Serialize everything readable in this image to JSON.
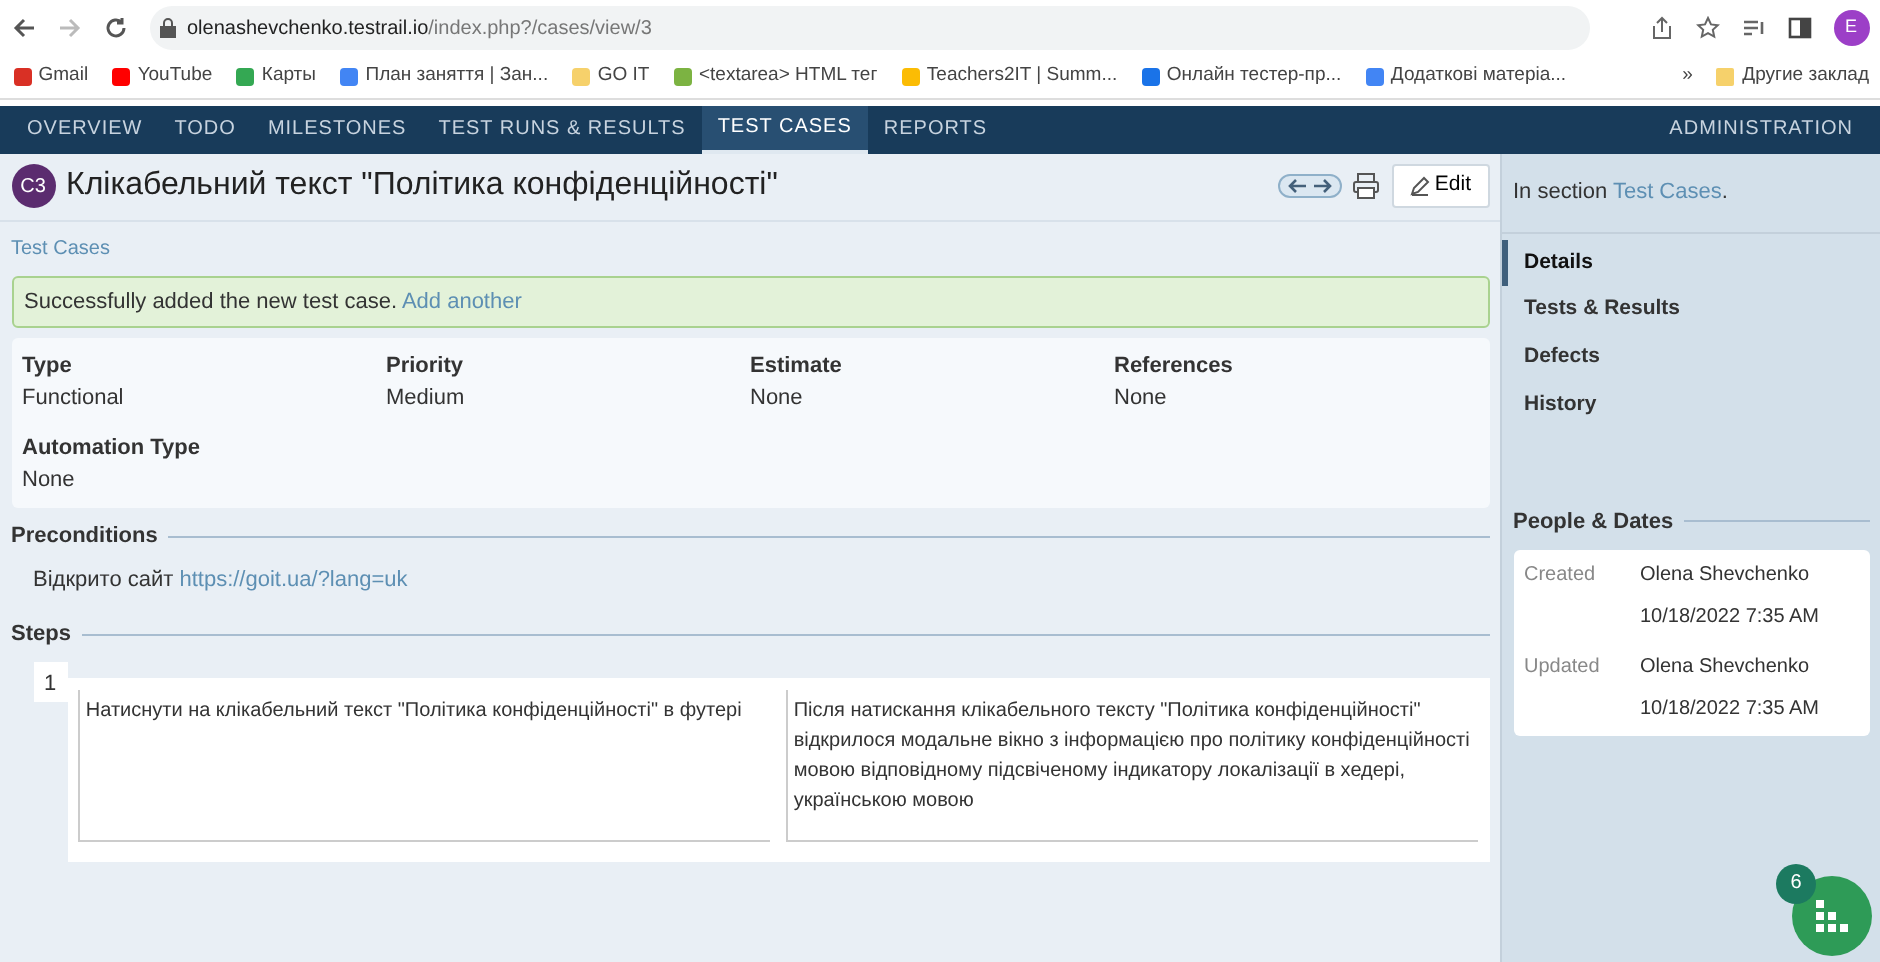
{
  "browser": {
    "url_host": "olenashevchenko.testrail.io",
    "url_path": "/index.php?/cases/view/3",
    "avatar": "E",
    "bookmarks": [
      {
        "label": "Gmail",
        "color": "#d93025"
      },
      {
        "label": "YouTube",
        "color": "#ff0000"
      },
      {
        "label": "Карты",
        "color": "#34a853"
      },
      {
        "label": "План заняття | Зан...",
        "color": "#4285f4"
      },
      {
        "label": "GO IT",
        "color": "#f6d16b"
      },
      {
        "label": "<textarea> HTML тег",
        "color": "#7cb342"
      },
      {
        "label": "Teachers2IT | Summ...",
        "color": "#fbbc04"
      },
      {
        "label": "Онлайн тестер-пр...",
        "color": "#1a73e8"
      },
      {
        "label": "Додаткові матеріа...",
        "color": "#4285f4"
      }
    ],
    "more": "»",
    "other_bookmarks": "Другие заклад"
  },
  "nav": {
    "items": [
      {
        "label": "OVERVIEW",
        "selected": false
      },
      {
        "label": "TODO",
        "selected": false
      },
      {
        "label": "MILESTONES",
        "selected": false
      },
      {
        "label": "TEST RUNS & RESULTS",
        "selected": false
      },
      {
        "label": "TEST CASES",
        "selected": true
      },
      {
        "label": "REPORTS",
        "selected": false
      }
    ],
    "admin": "ADMINISTRATION"
  },
  "case": {
    "badge": "C3",
    "title": "Клікабельний текст \"Політика конфіденційності\"",
    "edit": "Edit",
    "breadcrumb": "Test Cases",
    "alert": {
      "text": "Successfully added the new test case.",
      "link": "Add another"
    },
    "fields": [
      {
        "label": "Type",
        "value": "Functional"
      },
      {
        "label": "Priority",
        "value": "Medium"
      },
      {
        "label": "Estimate",
        "value": "None"
      },
      {
        "label": "References",
        "value": "None"
      },
      {
        "label": "Automation Type",
        "value": "None"
      }
    ],
    "preconditions": {
      "heading": "Preconditions",
      "text": "Відкрито сайт",
      "link": "https://goit.ua/?lang=uk"
    },
    "steps_heading": "Steps",
    "steps": [
      {
        "number": "1",
        "step": "Натиснути на клікабельний текст \"Політика конфіденційності\" в футері",
        "expected": "Після натискання клікабельного тексту \"Політика конфіденційності\" відкрилося модальне вікно з інформацією про політику конфіденційності мовою відповідному підсвіченому індикатору локалізації в хедері, українською мовою"
      }
    ]
  },
  "sidebar": {
    "section_prefix": "In section",
    "section_link": "Test Cases",
    "section_suffix": ".",
    "tabs": [
      {
        "label": "Details",
        "selected": true
      },
      {
        "label": "Tests & Results",
        "selected": false
      },
      {
        "label": "Defects",
        "selected": false
      },
      {
        "label": "History",
        "selected": false
      }
    ],
    "people_heading": "People & Dates",
    "people": [
      {
        "label": "Created",
        "name": "Olena Shevchenko",
        "date": "10/18/2022 7:35 AM"
      },
      {
        "label": "Updated",
        "name": "Olena Shevchenko",
        "date": "10/18/2022 7:35 AM"
      }
    ]
  },
  "widget": {
    "count": "6"
  }
}
